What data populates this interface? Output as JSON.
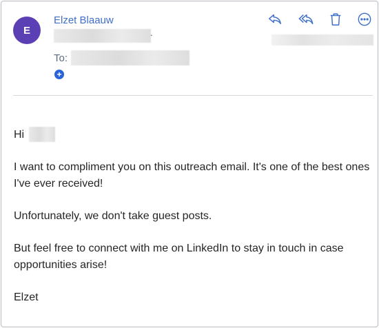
{
  "header": {
    "avatar_initial": "E",
    "sender_name": "Elzet Blaauw",
    "to_label": "To:",
    "add_recipient_symbol": "+",
    "actions": [
      {
        "name": "reply",
        "icon": "reply-icon"
      },
      {
        "name": "reply-all",
        "icon": "reply-all-icon"
      },
      {
        "name": "delete",
        "icon": "trash-icon"
      },
      {
        "name": "more",
        "icon": "more-options-icon"
      }
    ]
  },
  "message": {
    "greeting": "Hi",
    "paragraphs": [
      "I want to compliment you on this outreach email. It's one of the best ones I've ever received!",
      "Unfortunately, we don't take guest posts.",
      "But feel free to connect with me on LinkedIn to stay in touch in case opportunities arise!",
      "Elzet"
    ]
  },
  "colors": {
    "avatar_bg": "#5b3fb5",
    "accent": "#3f6fc8",
    "border": "#b7bcc2"
  }
}
